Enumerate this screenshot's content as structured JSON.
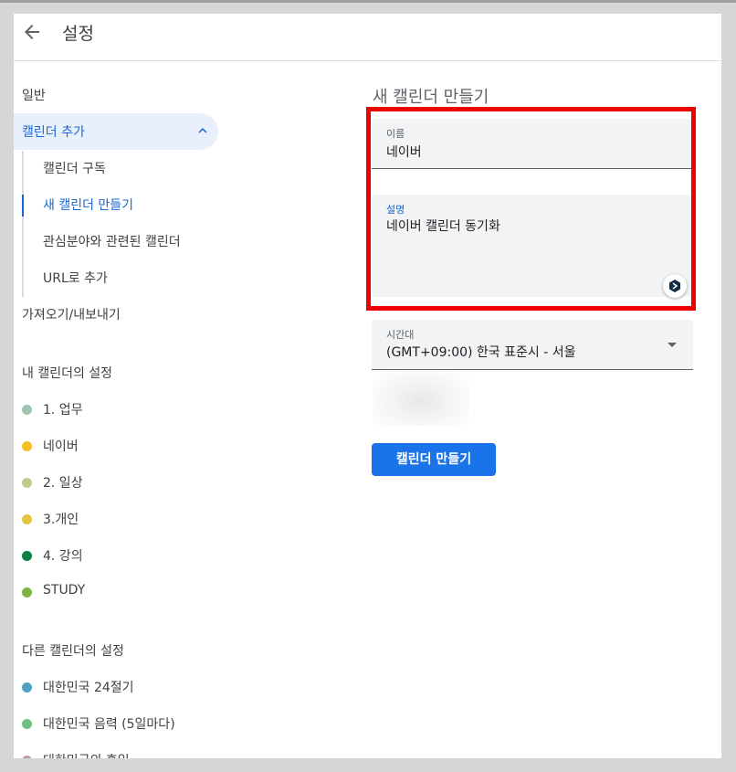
{
  "header": {
    "title": "설정"
  },
  "sidebar": {
    "general": "일반",
    "add_calendar": "캘린더 추가",
    "sub_items": [
      {
        "label": "캘린더 구독"
      },
      {
        "label": "새 캘린더 만들기"
      },
      {
        "label": "관심분야와 관련된 캘린더"
      },
      {
        "label": "URL로 추가"
      }
    ],
    "import_export": "가져오기/내보내기",
    "my_calendars_title": "내 캘린더의 설정",
    "my_calendars": [
      {
        "name": "1. 업무",
        "color": "#9fc6b1"
      },
      {
        "name": "네이버",
        "color": "#f6bf26"
      },
      {
        "name": "2. 일상",
        "color": "#c0ca8c"
      },
      {
        "name": "3.개인",
        "color": "#e4c441"
      },
      {
        "name": "4. 강의",
        "color": "#0b8043"
      },
      {
        "name": "STUDY",
        "color": "#7cb342"
      }
    ],
    "other_calendars_title": "다른 캘린더의 설정",
    "other_calendars": [
      {
        "name": "대한민국 24절기",
        "color": "#4fa1c4"
      },
      {
        "name": "대한민국 음력 (5일마다)",
        "color": "#6fbf85"
      },
      {
        "name": "대한민국의 휴일",
        "color": "#c79a9a"
      }
    ]
  },
  "main": {
    "title": "새 캘린더 만들기",
    "name_field": {
      "label": "이름",
      "value": "네이버"
    },
    "desc_field": {
      "label": "설명",
      "value": "네이버 캘린더 동기화"
    },
    "timezone_field": {
      "label": "시간대",
      "value": "(GMT+09:00) 한국 표준시 - 서울"
    },
    "create_button": "캘린더 만들기"
  }
}
